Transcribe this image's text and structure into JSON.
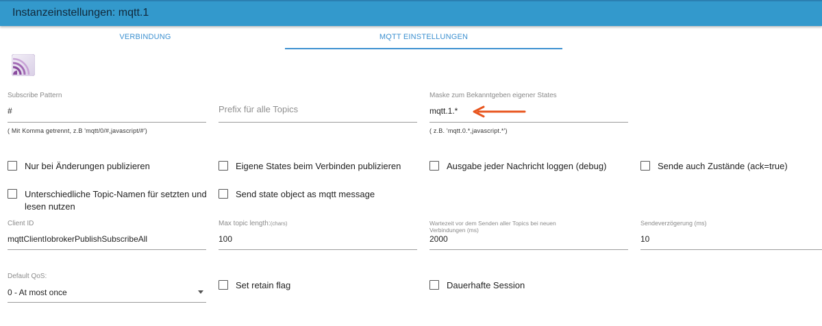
{
  "header": {
    "title": "Instanzeinstellungen: mqtt.1"
  },
  "tabs": [
    {
      "label": "VERBINDUNG"
    },
    {
      "label": "MQTT EINSTELLUNGEN"
    }
  ],
  "colors": {
    "header": "#3399cc",
    "accent": "#3a8fd0",
    "annotation_arrow": "#e8551e"
  },
  "icons": {
    "logo": "mqtt-logo-icon"
  },
  "fields": {
    "subscribe_pattern": {
      "label": "Subscribe Pattern",
      "value": "#",
      "helper": "( Mit Komma getrennt, z.B 'mqtt/0/#,javascript/#')"
    },
    "prefix": {
      "placeholder": "Prefix für alle Topics"
    },
    "mask": {
      "label": "Maske zum Bekanntgeben eigener States",
      "value": "mqtt.1.*",
      "helper": "( z.B. 'mqtt.0.*,javascript.*')"
    },
    "client_id": {
      "label": "Client ID",
      "value": "mqttClientIobrokerPublishSubscribeAll"
    },
    "max_topic_length": {
      "label": "Max topic length:",
      "label_suffix": "(chars)",
      "value": "100"
    },
    "wait_time": {
      "label": "Wartezeit vor dem Senden aller Topics bei neuen Verbindungen (ms)",
      "value": "2000"
    },
    "send_delay": {
      "label": "Sendeverzögerung (ms)",
      "value": "10"
    },
    "default_qos": {
      "label": "Default QoS:",
      "value": "0 - At most once"
    }
  },
  "checkboxes": {
    "only_changes": {
      "label": "Nur bei Änderungen publizieren",
      "checked": false
    },
    "own_states": {
      "label": "Eigene States beim Verbinden publizieren",
      "checked": false
    },
    "log_debug": {
      "label": "Ausgabe jeder Nachricht loggen (debug)",
      "checked": false
    },
    "send_ack": {
      "label": "Sende auch Zustände (ack=true)",
      "checked": false
    },
    "different_topics_line1": {
      "label": "Unterschiedliche Topic-Namen für setzten und"
    },
    "different_topics_line2": {
      "label": "lesen nutzen"
    },
    "state_object": {
      "label": "Send state object as mqtt message",
      "checked": false
    },
    "retain_flag": {
      "label": "Set retain flag",
      "checked": false
    },
    "persistent_session": {
      "label": "Dauerhafte Session",
      "checked": false
    }
  }
}
